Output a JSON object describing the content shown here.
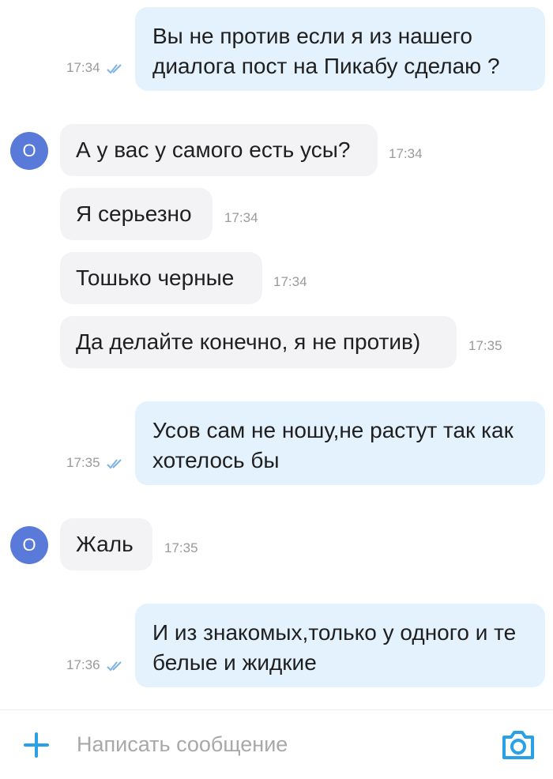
{
  "messages": [
    {
      "direction": "out",
      "text": "Вы не против если я из нашего диалога пост на Пикабу сделаю ?",
      "time": "17:34"
    },
    {
      "direction": "in",
      "avatar": "О",
      "text": "А у вас у самого есть усы?",
      "time": "17:34"
    },
    {
      "direction": "in",
      "text": "Я серьезно",
      "time": "17:34"
    },
    {
      "direction": "in",
      "text": "Тошько черные",
      "time": "17:34"
    },
    {
      "direction": "in",
      "text": "Да делайте конечно, я не против)",
      "time": "17:35"
    },
    {
      "direction": "out",
      "text": "Усов сам не ношу,не растут так как хотелось бы",
      "time": "17:35"
    },
    {
      "direction": "in",
      "avatar": "О",
      "text": "Жаль",
      "time": "17:35"
    },
    {
      "direction": "out",
      "text": "И из  знакомых,только у одного и те белые и жидкие",
      "time": "17:36"
    }
  ],
  "composer": {
    "placeholder": "Написать сообщение",
    "attach_icon": "plus-icon",
    "camera_icon": "camera-icon"
  },
  "colors": {
    "outgoing_bubble": "#e4f2fd",
    "incoming_bubble": "#f3f3f5",
    "avatar": "#5a7ad9",
    "accent": "#2aa1e6",
    "read_check": "#7cb3e0"
  }
}
